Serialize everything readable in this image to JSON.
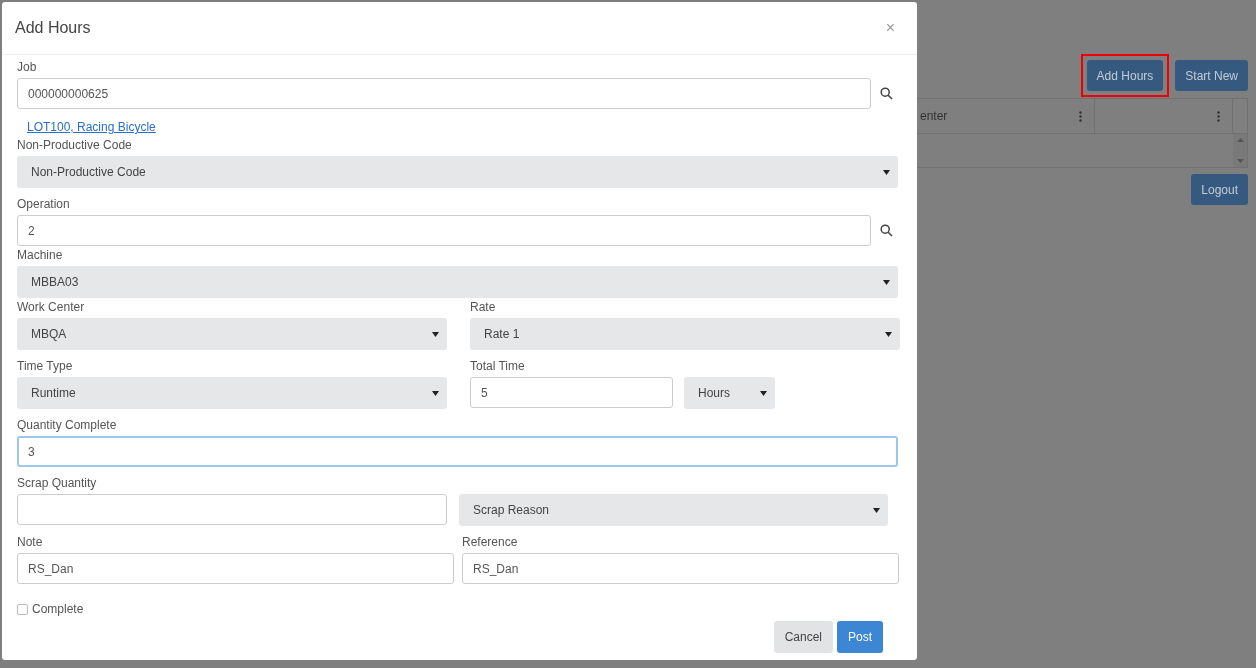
{
  "background": {
    "buttons": [
      {
        "label": "Add Hours",
        "highlighted": true
      },
      {
        "label": "Start New"
      }
    ],
    "table": {
      "columns": [
        {
          "label": "enter"
        },
        {}
      ]
    },
    "logout": "Logout"
  },
  "dialog": {
    "title": "Add Hours",
    "close": "×",
    "rows": [
      [
        {
          "kind": "input",
          "label": "Job",
          "value": "000000000625",
          "search": true
        }
      ],
      [
        {
          "kind": "link",
          "label": "LOT100, Racing Bicycle"
        }
      ],
      [
        {
          "kind": "select",
          "label": "Non-Productive Code",
          "value": "Non-Productive Code"
        }
      ],
      [
        {
          "kind": "input",
          "label": "Operation",
          "value": "2",
          "search": true
        }
      ],
      [
        {
          "kind": "select",
          "label": "Machine",
          "value": "MBBA03"
        }
      ],
      [
        {
          "kind": "select",
          "label": "Work Center",
          "value": "MBQA"
        },
        {
          "kind": "select",
          "label": "Rate",
          "value": "Rate 1"
        }
      ],
      [
        {
          "kind": "select",
          "label": "Time Type",
          "value": "Runtime"
        },
        {
          "kind": "input",
          "label": "Total Time",
          "value": "5"
        },
        {
          "kind": "unit",
          "value": "Hours"
        }
      ],
      [
        {
          "kind": "input",
          "label": "Quantity Complete",
          "value": "3",
          "focused": true
        }
      ],
      [
        {
          "kind": "input",
          "label": "Scrap Quantity"
        },
        {
          "kind": "select",
          "value": "Scrap Reason"
        }
      ],
      [
        {
          "kind": "input",
          "label": "Note",
          "value": "RS_Dan"
        },
        {
          "kind": "input",
          "label": "Reference",
          "value": "RS_Dan"
        }
      ],
      [
        {
          "kind": "checkbox",
          "label": "Complete",
          "checked": false
        }
      ]
    ],
    "buttons": [
      {
        "label": "Cancel",
        "kind": "secondary"
      },
      {
        "label": "Post",
        "kind": "primary"
      }
    ]
  }
}
